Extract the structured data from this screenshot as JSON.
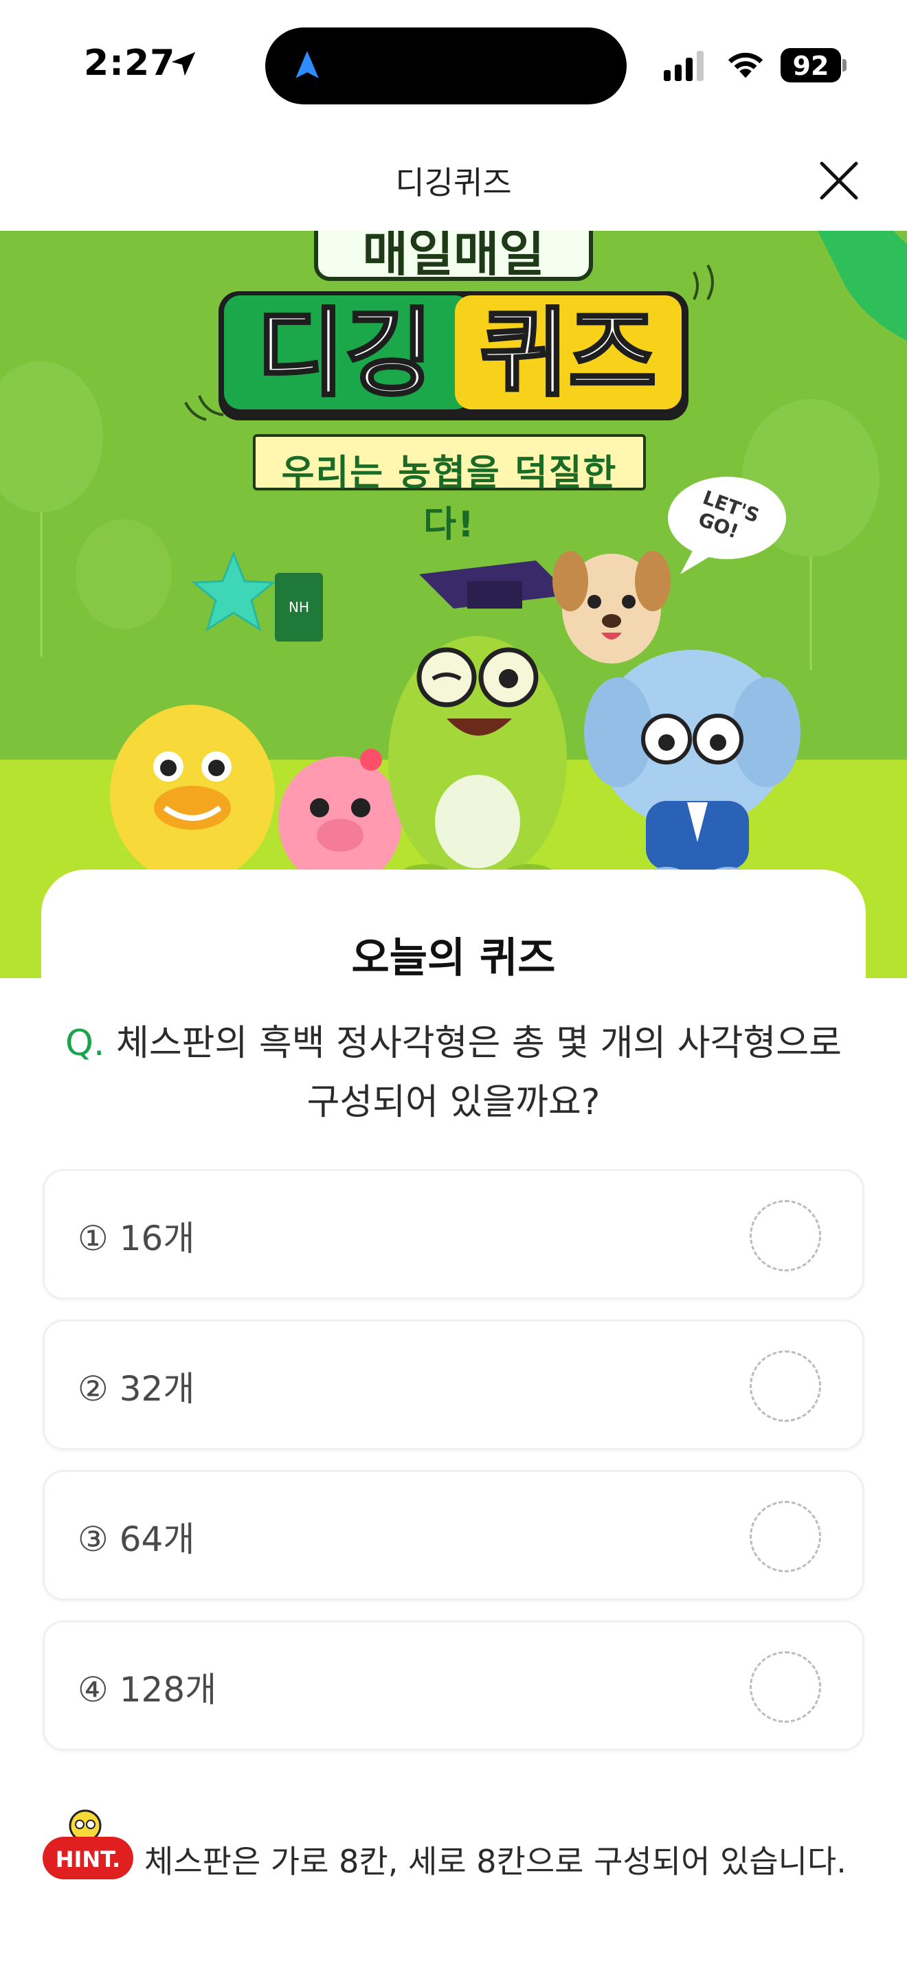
{
  "status_bar": {
    "time": "2:27",
    "battery": "92"
  },
  "header": {
    "title": "디깅퀴즈"
  },
  "banner": {
    "top_text": "매일매일",
    "main_left": "디깅",
    "main_right": "퀴즈",
    "subtitle": "우리는 농협을 덕질한다!",
    "bubble": "LET'S GO!",
    "book_label": "NH"
  },
  "card": {
    "title": "오늘의 퀴즈"
  },
  "question": {
    "mark": "Q.",
    "text": "체스판의 흑백 정사각형은 총 몇 개의 사각형으로 구성되어 있을까요?"
  },
  "options": [
    {
      "label": "① 16개"
    },
    {
      "label": "② 32개"
    },
    {
      "label": "③ 64개"
    },
    {
      "label": "④ 128개"
    }
  ],
  "hint": {
    "badge": "HINT.",
    "text": "체스판은 가로 8칸, 세로 8칸으로 구성되어 있습니다."
  },
  "colors": {
    "brand_green": "#19a34a",
    "hero_bg": "#7cc23a",
    "hero_ground": "#b5e32f",
    "hint_red": "#e02020"
  }
}
